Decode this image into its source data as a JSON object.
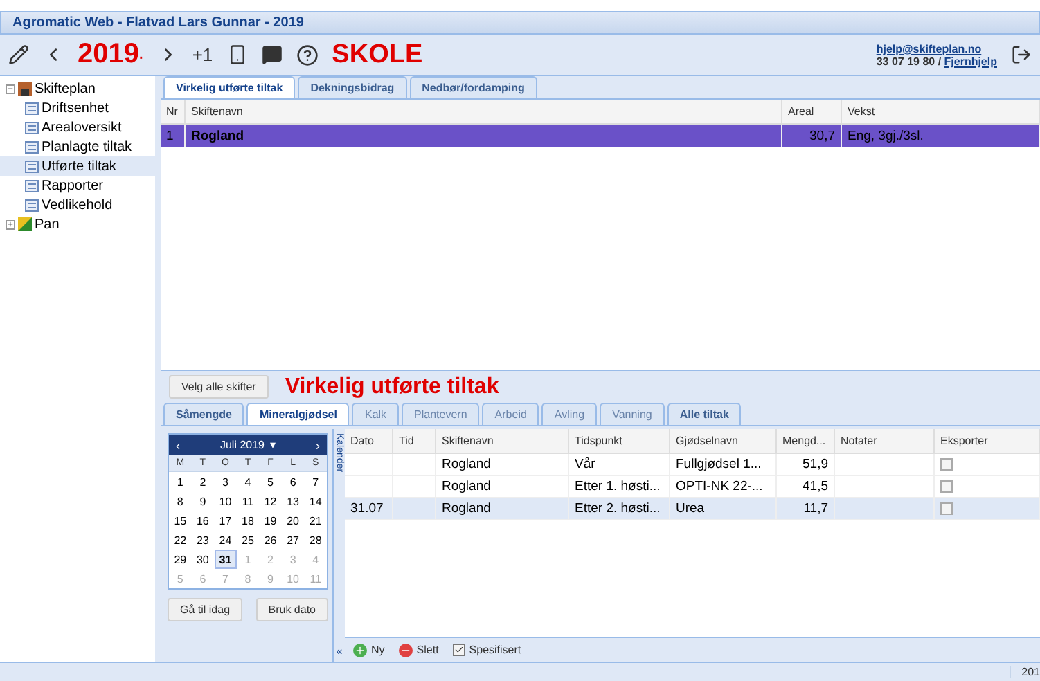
{
  "window": {
    "title": "Agromatic Web - Flatvad Lars Gunnar - 2019"
  },
  "toolbar": {
    "year": "2019",
    "year_caret": "·",
    "plus_one": "+1",
    "label": "SKOLE",
    "email": "hjelp@skifteplan.no",
    "phone": "33 07 19 80 / ",
    "remote_help": "Fjernhjelp"
  },
  "tree": [
    {
      "label": "Skifteplan",
      "expanded": true,
      "selected": false,
      "kind": "plan",
      "children": [
        {
          "label": "Driftsenhet",
          "selected": false
        },
        {
          "label": "Arealoversikt",
          "selected": false
        },
        {
          "label": "Planlagte tiltak",
          "selected": false
        },
        {
          "label": "Utførte tiltak",
          "selected": true
        },
        {
          "label": "Rapporter",
          "selected": false
        },
        {
          "label": "Vedlikehold",
          "selected": false
        }
      ]
    },
    {
      "label": "Pan",
      "expanded": false,
      "selected": false,
      "kind": "map"
    }
  ],
  "top_tabs": [
    {
      "label": "Virkelig utførte tiltak",
      "selected": true
    },
    {
      "label": "Dekningsbidrag",
      "selected": false
    },
    {
      "label": "Nedbør/fordamping",
      "selected": false
    }
  ],
  "upper_table": {
    "columns": [
      "Nr",
      "Skiftenavn",
      "Areal",
      "Vekst"
    ],
    "rows": [
      {
        "cells": [
          "1",
          "Rogland",
          "30,7",
          "Eng, 3gj./3sl."
        ],
        "selected": true
      }
    ]
  },
  "select_all_button": "Velg alle skifter",
  "section_title": "Virkelig utførte tiltak",
  "lower_tabs": [
    {
      "label": "Såmengde",
      "selected": false,
      "disabled": false
    },
    {
      "label": "Mineralgjødsel",
      "selected": true,
      "disabled": false
    },
    {
      "label": "Kalk",
      "selected": false,
      "disabled": true
    },
    {
      "label": "Plantevern",
      "selected": false,
      "disabled": true
    },
    {
      "label": "Arbeid",
      "selected": false,
      "disabled": true
    },
    {
      "label": "Avling",
      "selected": false,
      "disabled": true
    },
    {
      "label": "Vanning",
      "selected": false,
      "disabled": true
    },
    {
      "label": "Alle tiltak",
      "selected": false,
      "disabled": false
    }
  ],
  "calendar": {
    "month": "Juli 2019",
    "prev": "‹",
    "next": "›",
    "caret": "▾",
    "weekdays": [
      "M",
      "T",
      "O",
      "T",
      "F",
      "L",
      "S"
    ],
    "weeks": [
      [
        {
          "d": "1",
          "muted": false,
          "selected": false
        },
        {
          "d": "2",
          "muted": false,
          "selected": false
        },
        {
          "d": "3",
          "muted": false,
          "selected": false
        },
        {
          "d": "4",
          "muted": false,
          "selected": false
        },
        {
          "d": "5",
          "muted": false,
          "selected": false
        },
        {
          "d": "6",
          "muted": false,
          "selected": false
        },
        {
          "d": "7",
          "muted": false,
          "selected": false
        }
      ],
      [
        {
          "d": "8",
          "muted": false,
          "selected": false
        },
        {
          "d": "9",
          "muted": false,
          "selected": false
        },
        {
          "d": "10",
          "muted": false,
          "selected": false
        },
        {
          "d": "11",
          "muted": false,
          "selected": false
        },
        {
          "d": "12",
          "muted": false,
          "selected": false
        },
        {
          "d": "13",
          "muted": false,
          "selected": false
        },
        {
          "d": "14",
          "muted": false,
          "selected": false
        }
      ],
      [
        {
          "d": "15",
          "muted": false,
          "selected": false
        },
        {
          "d": "16",
          "muted": false,
          "selected": false
        },
        {
          "d": "17",
          "muted": false,
          "selected": false
        },
        {
          "d": "18",
          "muted": false,
          "selected": false
        },
        {
          "d": "19",
          "muted": false,
          "selected": false
        },
        {
          "d": "20",
          "muted": false,
          "selected": false
        },
        {
          "d": "21",
          "muted": false,
          "selected": false
        }
      ],
      [
        {
          "d": "22",
          "muted": false,
          "selected": false
        },
        {
          "d": "23",
          "muted": false,
          "selected": false
        },
        {
          "d": "24",
          "muted": false,
          "selected": false
        },
        {
          "d": "25",
          "muted": false,
          "selected": false
        },
        {
          "d": "26",
          "muted": false,
          "selected": false
        },
        {
          "d": "27",
          "muted": false,
          "selected": false
        },
        {
          "d": "28",
          "muted": false,
          "selected": false
        }
      ],
      [
        {
          "d": "29",
          "muted": false,
          "selected": false
        },
        {
          "d": "30",
          "muted": false,
          "selected": false
        },
        {
          "d": "31",
          "muted": false,
          "selected": true
        },
        {
          "d": "1",
          "muted": true,
          "selected": false
        },
        {
          "d": "2",
          "muted": true,
          "selected": false
        },
        {
          "d": "3",
          "muted": true,
          "selected": false
        },
        {
          "d": "4",
          "muted": true,
          "selected": false
        }
      ],
      [
        {
          "d": "5",
          "muted": true,
          "selected": false
        },
        {
          "d": "6",
          "muted": true,
          "selected": false
        },
        {
          "d": "7",
          "muted": true,
          "selected": false
        },
        {
          "d": "8",
          "muted": true,
          "selected": false
        },
        {
          "d": "9",
          "muted": true,
          "selected": false
        },
        {
          "d": "10",
          "muted": true,
          "selected": false
        },
        {
          "d": "11",
          "muted": true,
          "selected": false
        }
      ]
    ],
    "today_button": "Gå til idag",
    "use_date_button": "Bruk dato",
    "side_label": "Kalender",
    "collapse": "«"
  },
  "lower_table": {
    "columns": [
      "Dato",
      "Tid",
      "Skiftenavn",
      "Tidspunkt",
      "Gjødselnavn",
      "Mengd...",
      "Notater",
      "Eksporter"
    ],
    "rows": [
      {
        "cells": [
          "",
          "",
          "Rogland",
          "Vår",
          "Fullgjødsel 1...",
          "51,9",
          ""
        ],
        "export": false,
        "selected": false
      },
      {
        "cells": [
          "",
          "",
          "Rogland",
          "Etter 1. høsti...",
          "OPTI-NK 22-...",
          "41,5",
          ""
        ],
        "export": false,
        "selected": false
      },
      {
        "cells": [
          "31.07",
          "",
          "Rogland",
          "Etter 2. høsti...",
          "Urea",
          "11,7",
          ""
        ],
        "export": false,
        "selected": true
      }
    ]
  },
  "grid_toolbar": {
    "new": "Ny",
    "delete": "Slett",
    "specified": {
      "label": "Spesifisert",
      "checked": true
    }
  },
  "status_bar": {
    "year": "201"
  }
}
